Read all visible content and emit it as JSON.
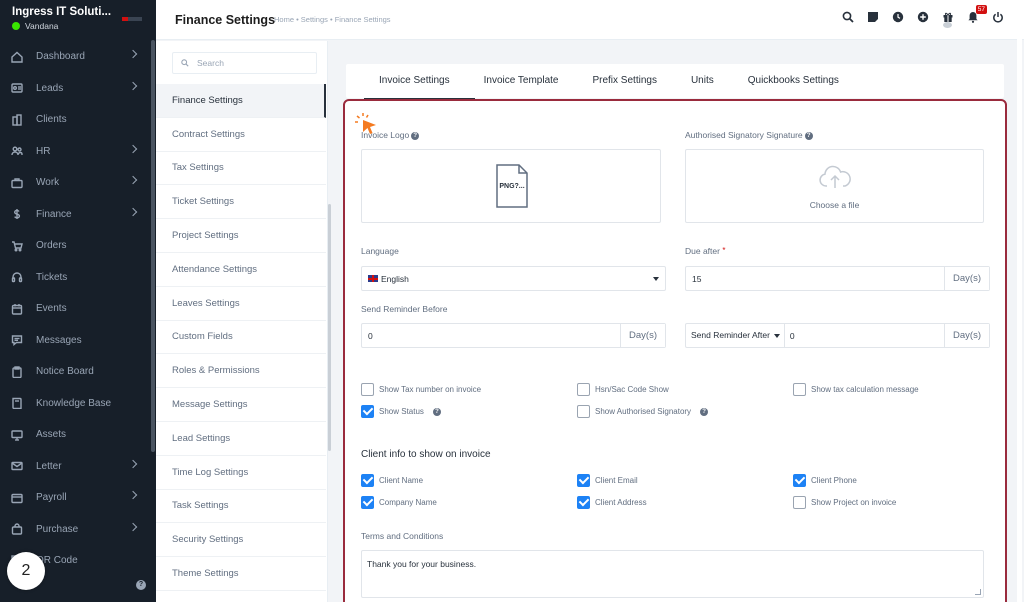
{
  "app": {
    "company": "Ingress IT Soluti...",
    "user": "Vandana",
    "step_number": "2"
  },
  "sidebar": {
    "items": [
      {
        "label": "Dashboard",
        "icon": "home-icon",
        "has_arrow": true
      },
      {
        "label": "Leads",
        "icon": "id-card-icon",
        "has_arrow": true
      },
      {
        "label": "Clients",
        "icon": "building-icon",
        "has_arrow": false
      },
      {
        "label": "HR",
        "icon": "people-icon",
        "has_arrow": true
      },
      {
        "label": "Work",
        "icon": "briefcase-icon",
        "has_arrow": true
      },
      {
        "label": "Finance",
        "icon": "dollar-icon",
        "has_arrow": true
      },
      {
        "label": "Orders",
        "icon": "cart-icon",
        "has_arrow": false
      },
      {
        "label": "Tickets",
        "icon": "headset-icon",
        "has_arrow": false
      },
      {
        "label": "Events",
        "icon": "calendar-icon",
        "has_arrow": false
      },
      {
        "label": "Messages",
        "icon": "chat-icon",
        "has_arrow": false
      },
      {
        "label": "Notice Board",
        "icon": "clipboard-icon",
        "has_arrow": false
      },
      {
        "label": "Knowledge Base",
        "icon": "book-icon",
        "has_arrow": false
      },
      {
        "label": "Assets",
        "icon": "monitor-icon",
        "has_arrow": false
      },
      {
        "label": "Letter",
        "icon": "envelope-icon",
        "has_arrow": true
      },
      {
        "label": "Payroll",
        "icon": "wallet-icon",
        "has_arrow": true
      },
      {
        "label": "Purchase",
        "icon": "bag-icon",
        "has_arrow": true
      },
      {
        "label": "QR Code",
        "icon": "qr-icon",
        "has_arrow": false
      }
    ]
  },
  "header": {
    "title": "Finance Settings",
    "breadcrumb": "Home • Settings • Finance Settings",
    "notification_count": "57"
  },
  "settings_menu": {
    "search_placeholder": "Search",
    "items": [
      "Finance Settings",
      "Contract Settings",
      "Tax Settings",
      "Ticket Settings",
      "Project Settings",
      "Attendance Settings",
      "Leaves Settings",
      "Custom Fields",
      "Roles & Permissions",
      "Message Settings",
      "Lead Settings",
      "Time Log Settings",
      "Task Settings",
      "Security Settings",
      "Theme Settings"
    ],
    "active_index": 0
  },
  "tabs": [
    "Invoice Settings",
    "Invoice Template",
    "Prefix Settings",
    "Units",
    "Quickbooks Settings"
  ],
  "form": {
    "invoice_logo_label": "Invoice Logo",
    "logo_placeholder_text": "PNG?...",
    "signature_label": "Authorised Signatory Signature",
    "choose_file": "Choose a file",
    "language_label": "Language",
    "language_value": "English",
    "due_after_label": "Due after",
    "due_after_value": "15",
    "days_unit": "Day(s)",
    "send_reminder_before_label": "Send Reminder Before",
    "send_reminder_before_value": "0",
    "send_reminder_after_select": "Send Reminder After",
    "send_reminder_after_value": "0",
    "options": [
      {
        "label": "Show Tax number on invoice",
        "checked": false,
        "help": false
      },
      {
        "label": "Hsn/Sac Code Show",
        "checked": false,
        "help": false
      },
      {
        "label": "Show tax calculation message",
        "checked": false,
        "help": false
      },
      {
        "label": "Show Status",
        "checked": true,
        "help": true
      },
      {
        "label": "Show Authorised Signatory",
        "checked": false,
        "help": true
      }
    ],
    "client_info_title": "Client info to show on invoice",
    "client_info": [
      {
        "label": "Client Name",
        "checked": true
      },
      {
        "label": "Client Email",
        "checked": true
      },
      {
        "label": "Client Phone",
        "checked": true
      },
      {
        "label": "Company Name",
        "checked": true
      },
      {
        "label": "Client Address",
        "checked": true
      },
      {
        "label": "Show Project on invoice",
        "checked": false
      }
    ],
    "terms_label": "Terms and Conditions",
    "terms_value": "Thank you for your business."
  },
  "colors": {
    "sidebar_bg": "#171f29",
    "accent_blue": "#1d82f5",
    "highlight_border": "#9a2b3d",
    "badge_red": "#d21010"
  }
}
